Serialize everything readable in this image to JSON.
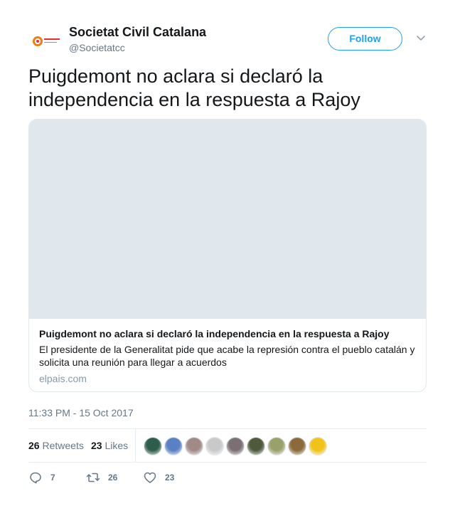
{
  "author": {
    "display_name": "Societat Civil Catalana",
    "handle": "@Societatcc",
    "avatar_icon": "societat-civil-catalana-logo"
  },
  "follow_label": "Follow",
  "tweet": {
    "text": "Puigdemont no aclara si declaró la independencia en la respuesta a Rajoy"
  },
  "card": {
    "title": "Puigdemont no aclara si declaró la independencia en la respuesta a Rajoy",
    "description": "El presidente de la Generalitat pide que acabe la represión contra el pueblo catalán y solicita una reunión para llegar a acuerdos",
    "domain": "elpais.com"
  },
  "timestamp": "11:33 PM - 15 Oct 2017",
  "stats": {
    "retweets_count": "26",
    "retweets_label": "Retweets",
    "likes_count": "23",
    "likes_label": "Likes"
  },
  "likers": [
    {
      "color": "#2e5d4b"
    },
    {
      "color": "#5a7fc2"
    },
    {
      "color": "#a08a86"
    },
    {
      "color": "#c9c9c9"
    },
    {
      "color": "#7c6f74"
    },
    {
      "color": "#4f5a3c"
    },
    {
      "color": "#9aa06a"
    },
    {
      "color": "#8a6a3a"
    },
    {
      "color": "#f0c21a"
    }
  ],
  "actions": {
    "reply_count": "7",
    "retweet_count": "26",
    "like_count": "23"
  },
  "colors": {
    "accent": "#1da1f2",
    "text": "#14171a",
    "muted": "#657786",
    "border": "#e6ecf0"
  }
}
